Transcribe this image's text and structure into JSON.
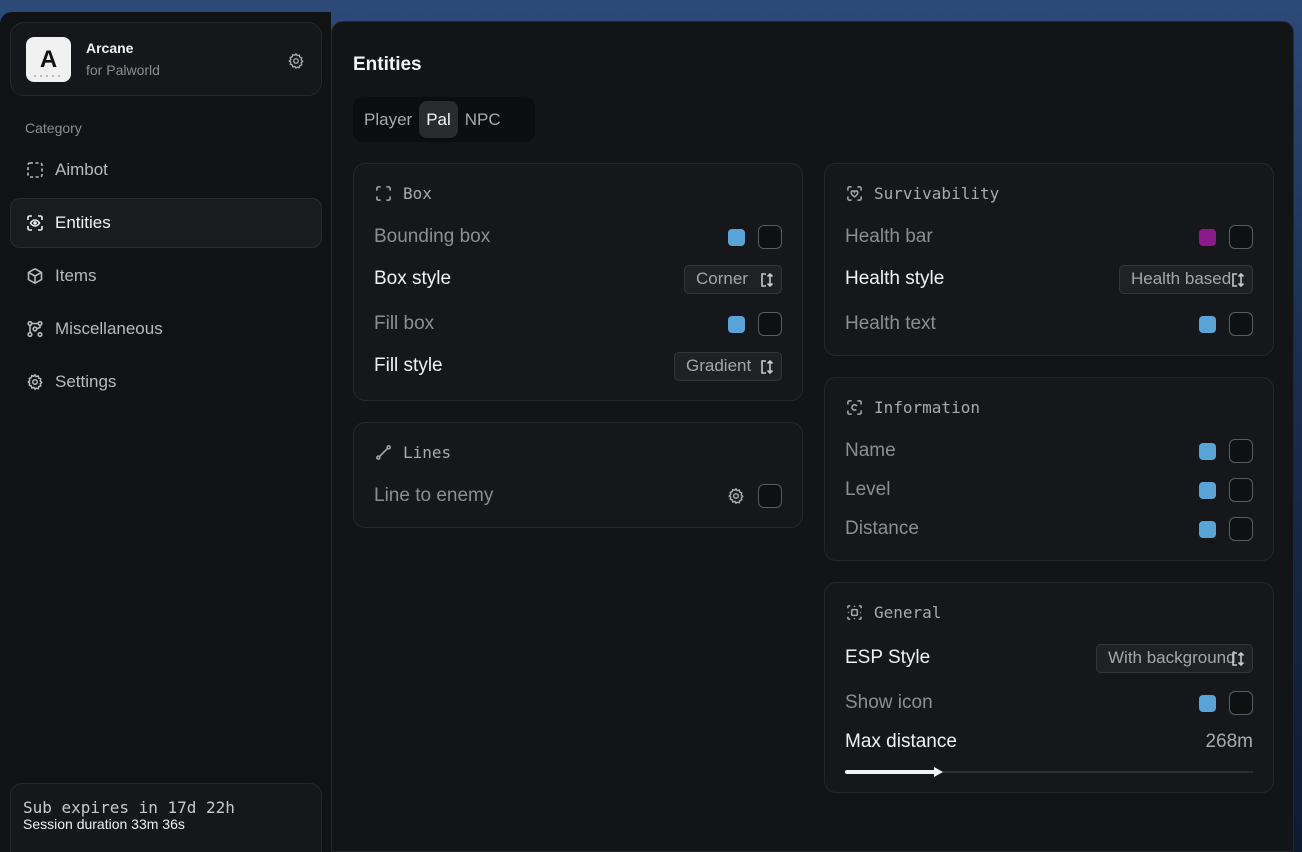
{
  "brand": {
    "title": "Arcane",
    "subtitle": "for Palworld",
    "logo_letter": "A"
  },
  "sidebar": {
    "category_label": "Category",
    "items": [
      {
        "label": "Aimbot",
        "icon": "dashed-square-icon"
      },
      {
        "label": "Entities",
        "icon": "scan-eye-icon",
        "active": true
      },
      {
        "label": "Items",
        "icon": "cube-icon"
      },
      {
        "label": "Miscellaneous",
        "icon": "nodes-icon"
      },
      {
        "label": "Settings",
        "icon": "gear-icon"
      }
    ]
  },
  "footer": {
    "sub_expires": "Sub expires in 17d 22h",
    "session": "Session duration 33m 36s"
  },
  "main": {
    "title": "Entities",
    "tabs": [
      "Player",
      "Pal",
      "NPC"
    ],
    "active_tab": "Pal"
  },
  "cards": {
    "box": {
      "title": "Box",
      "bounding_box": "Bounding box",
      "box_style": "Box style",
      "box_style_value": "Corner",
      "fill_box": "Fill box",
      "fill_style": "Fill style",
      "fill_style_value": "Gradient"
    },
    "lines": {
      "title": "Lines",
      "line_to_enemy": "Line to enemy"
    },
    "survivability": {
      "title": "Survivability",
      "health_bar": "Health bar",
      "health_style": "Health style",
      "health_style_value": "Health based",
      "health_text": "Health text"
    },
    "information": {
      "title": "Information",
      "name": "Name",
      "level": "Level",
      "distance": "Distance"
    },
    "general": {
      "title": "General",
      "esp_style": "ESP Style",
      "esp_style_value": "With background",
      "show_icon": "Show icon",
      "max_distance": "Max distance",
      "max_distance_value": "268m",
      "max_distance_fraction": 0.23
    }
  },
  "colors": {
    "accent_blue": "#5aa3d6",
    "accent_purple": "#8a1a8a",
    "panel": "#16171a",
    "background": "#111214"
  }
}
